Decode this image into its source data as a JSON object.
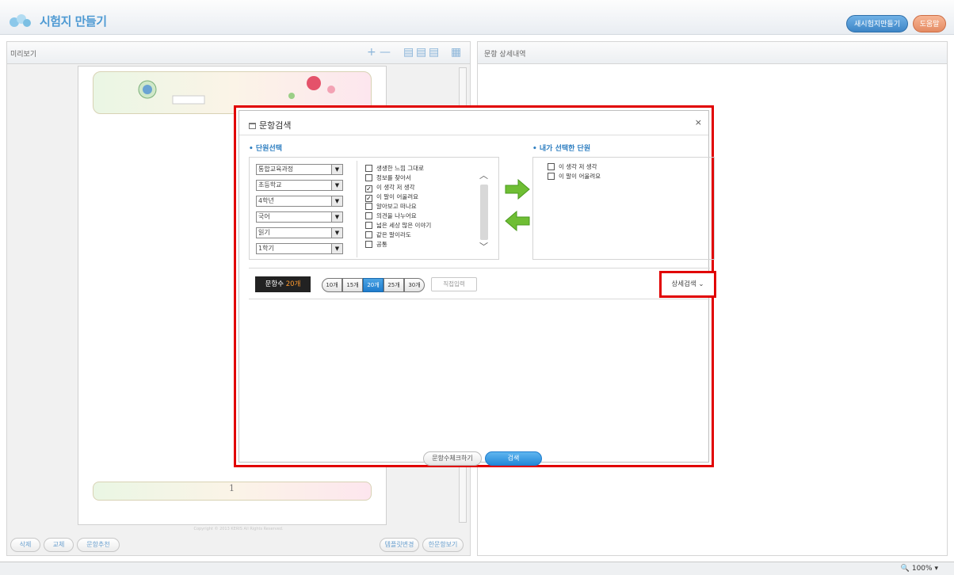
{
  "header": {
    "title": "시험지 만들기",
    "new_button": "새시험지만들기",
    "help_button": "도움말"
  },
  "preview": {
    "title": "미리보기",
    "page_number": "1",
    "copyright": "Copyright © 2013 KERIS All Rights Reserved.",
    "footer_buttons": [
      "삭제",
      "교체",
      "문항추천"
    ],
    "footer_right_buttons": [
      "템플릿변경",
      "한문항보기"
    ]
  },
  "detail": {
    "title": "문항 상세내역"
  },
  "status": {
    "zoom": "100%"
  },
  "dialog": {
    "title": "문항검색",
    "close": "×",
    "unit_section_label": "• 단원선택",
    "selected_section_label": "• 내가 선택한 단원",
    "selects": [
      "통합교육과정",
      "초등학교",
      "4학년",
      "국어",
      "읽기",
      "1학기"
    ],
    "units": [
      {
        "label": "생생한 느낌 그대로",
        "checked": false
      },
      {
        "label": "정보를 찾아서",
        "checked": false
      },
      {
        "label": "이 생각 저 생각",
        "checked": true
      },
      {
        "label": "이 말이 어울려요",
        "checked": true
      },
      {
        "label": "알아보고 떠나요",
        "checked": false
      },
      {
        "label": "의견을 나누어요",
        "checked": false
      },
      {
        "label": "넓은 세상 많은 이야기",
        "checked": false
      },
      {
        "label": "같은 말이라도",
        "checked": false
      },
      {
        "label": "공통",
        "checked": false
      }
    ],
    "selected_units": [
      "이 생각 저 생각",
      "이 말이 어울려요"
    ],
    "count_label": "문항수",
    "count_value": "20개",
    "count_options": [
      "10개",
      "15개",
      "20개",
      "25개",
      "30개"
    ],
    "count_active": "20개",
    "direct_input": "직접입력",
    "detail_search": "상세검색 ⌄",
    "check_count_button": "문항수체크하기",
    "search_button": "검색"
  }
}
